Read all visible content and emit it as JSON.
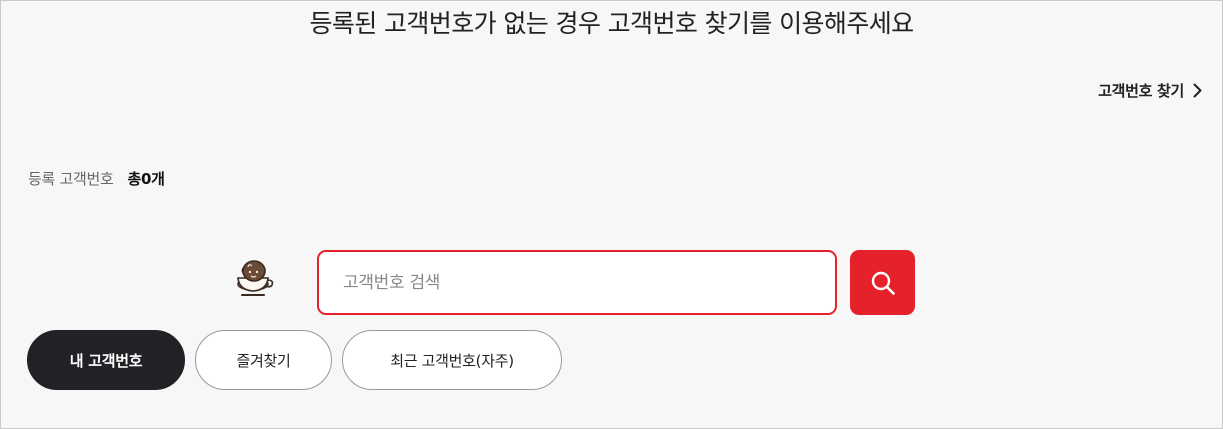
{
  "header": {
    "headline": "등록된 고객번호가 없는 경우 고객번호 찾기를 이용해주세요",
    "find_link_label": "고객번호 찾기"
  },
  "summary": {
    "label": "등록 고객번호",
    "count_text": "총0개"
  },
  "search": {
    "value": "",
    "placeholder": "고객번호 검색"
  },
  "tabs": [
    {
      "label": "내 고객번호",
      "active": true
    },
    {
      "label": "즐겨찾기",
      "active": false
    },
    {
      "label": "최근 고객번호(자주)",
      "active": false
    }
  ],
  "colors": {
    "accent": "#e5222b",
    "active_tab": "#222226",
    "background": "#f7f7f7"
  },
  "icons": {
    "find_link": "chevron-right-icon",
    "search_button": "search-icon",
    "mascot": "coffee-cup-mascot-icon"
  }
}
